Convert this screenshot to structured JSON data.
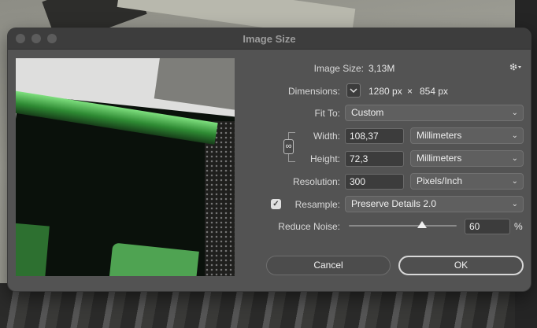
{
  "window": {
    "title": "Image Size"
  },
  "image_size": {
    "label": "Image Size:",
    "value": "3,13M"
  },
  "dimensions": {
    "label": "Dimensions:",
    "width": "1280 px",
    "times": "×",
    "height": "854 px"
  },
  "fit_to": {
    "label": "Fit To:",
    "value": "Custom"
  },
  "width": {
    "label": "Width:",
    "value": "108,37",
    "unit": "Millimeters"
  },
  "height": {
    "label": "Height:",
    "value": "72,3",
    "unit": "Millimeters"
  },
  "resolution": {
    "label": "Resolution:",
    "value": "300",
    "unit": "Pixels/Inch"
  },
  "resample": {
    "label": "Resample:",
    "checked": true,
    "value": "Preserve Details 2.0"
  },
  "reduce_noise": {
    "label": "Reduce Noise:",
    "value": "60",
    "unit": "%",
    "level_fraction": 0.68
  },
  "buttons": {
    "cancel": "Cancel",
    "ok": "OK"
  },
  "icons": {
    "settings": "gear-icon",
    "link": "link-icon",
    "chevron": "chevron-down-icon",
    "check": "checkmark-icon"
  }
}
